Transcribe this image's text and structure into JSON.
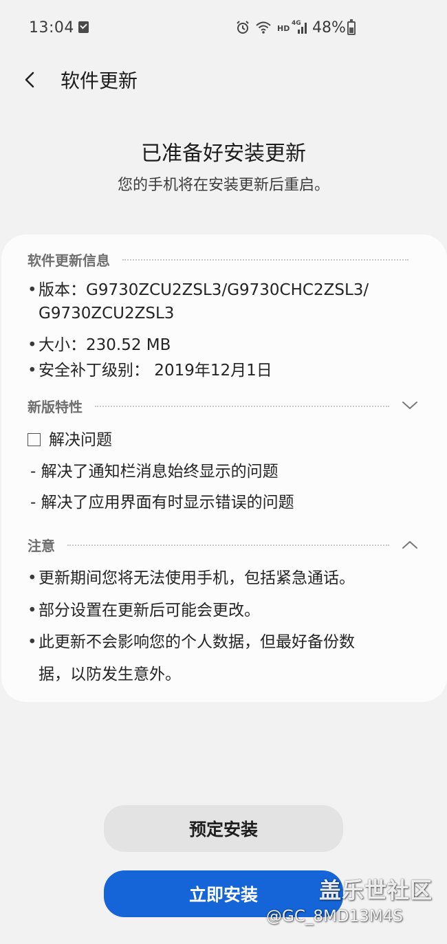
{
  "status_bar": {
    "time": "13:04",
    "network_label": "HD",
    "signal_label": "4G",
    "battery_text": "48%"
  },
  "toolbar": {
    "title": "软件更新"
  },
  "header": {
    "headline": "已准备好安装更新",
    "subline": "您的手机将在安装更新后重启。"
  },
  "info_section": {
    "title": "软件更新信息",
    "version_line1": "版本：G9730ZCU2ZSL3/G9730CHC2ZSL3/",
    "version_line2": "G9730ZCU2ZSL3",
    "size": "大小：230.52 MB",
    "patch": "安全补丁级别：  2019年12月1日"
  },
  "features_section": {
    "title": "新版特性",
    "group_label": "解决问题",
    "items": [
      "- 解决了通知栏消息始终显示的问题",
      "- 解决了应用界面有时显示错误的问题"
    ]
  },
  "notes_section": {
    "title": "注意",
    "items": [
      "更新期间您将无法使用手机，包括紧急通话。",
      "部分设置在更新后可能会更改。",
      "此更新不会影响您的个人数据，但最好备份数",
      "据，以防发生意外。"
    ]
  },
  "buttons": {
    "schedule": "预定安装",
    "install_now": "立即安装"
  },
  "watermark": {
    "site": "盖乐世社区",
    "user": "@GC_8MD13M4S"
  },
  "colors": {
    "background": "#f2f2f2",
    "card": "#fcfcfc",
    "primary": "#1565d8",
    "secondary_button": "#e3e3e3"
  }
}
